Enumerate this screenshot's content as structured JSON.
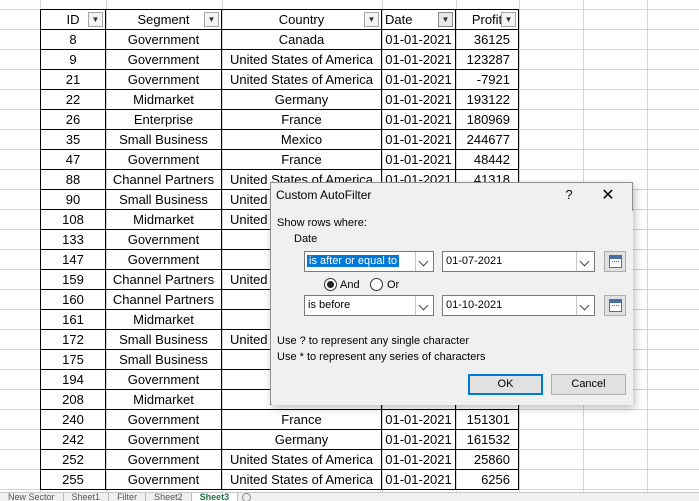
{
  "sheet": {
    "headers": [
      "ID",
      "Segment",
      "Country",
      "Date",
      "Profit"
    ],
    "rows": [
      [
        "8",
        "Government",
        "Canada",
        "01-01-2021",
        "36125"
      ],
      [
        "9",
        "Government",
        "United States of America",
        "01-01-2021",
        "123287"
      ],
      [
        "21",
        "Government",
        "United States of America",
        "01-01-2021",
        "-7921"
      ],
      [
        "22",
        "Midmarket",
        "Germany",
        "01-01-2021",
        "193122"
      ],
      [
        "26",
        "Enterprise",
        "France",
        "01-01-2021",
        "180969"
      ],
      [
        "35",
        "Small Business",
        "Mexico",
        "01-01-2021",
        "244677"
      ],
      [
        "47",
        "Government",
        "France",
        "01-01-2021",
        "48442"
      ],
      [
        "88",
        "Channel Partners",
        "United States of America",
        "01-01-2021",
        "41318"
      ],
      [
        "90",
        "Small Business",
        "United States of America",
        "",
        ""
      ],
      [
        "108",
        "Midmarket",
        "United States of America",
        "",
        ""
      ],
      [
        "133",
        "Government",
        "",
        "",
        ""
      ],
      [
        "147",
        "Government",
        "",
        "",
        ""
      ],
      [
        "159",
        "Channel Partners",
        "United States of America",
        "",
        ""
      ],
      [
        "160",
        "Channel Partners",
        "",
        "",
        ""
      ],
      [
        "161",
        "Midmarket",
        "",
        "",
        ""
      ],
      [
        "172",
        "Small Business",
        "United States of America",
        "",
        ""
      ],
      [
        "175",
        "Small Business",
        "",
        "",
        ""
      ],
      [
        "194",
        "Government",
        "",
        "",
        ""
      ],
      [
        "208",
        "Midmarket",
        "",
        "",
        ""
      ],
      [
        "240",
        "Government",
        "France",
        "01-01-2021",
        "151301"
      ],
      [
        "242",
        "Government",
        "Germany",
        "01-01-2021",
        "161532"
      ],
      [
        "252",
        "Government",
        "United States of America",
        "01-01-2021",
        "25860"
      ],
      [
        "255",
        "Government",
        "United States of America",
        "01-01-2021",
        "6256"
      ]
    ],
    "tabs": [
      "New Sector",
      "Sheet1",
      "Filter",
      "Sheet2",
      "Sheet3"
    ]
  },
  "dialog": {
    "title": "Custom AutoFilter",
    "help": "?",
    "close": "✕",
    "show_rows_label": "Show rows where:",
    "field_label": "Date",
    "condition1": {
      "operator": "is after or equal to",
      "value": "01-07-2021"
    },
    "logic": {
      "and_label": "And",
      "or_label": "Or",
      "selected": "And"
    },
    "condition2": {
      "operator": "is before",
      "value": "01-10-2021"
    },
    "hint1": "Use ? to represent any single character",
    "hint2": "Use * to represent any series of characters",
    "ok_label": "OK",
    "cancel_label": "Cancel"
  }
}
